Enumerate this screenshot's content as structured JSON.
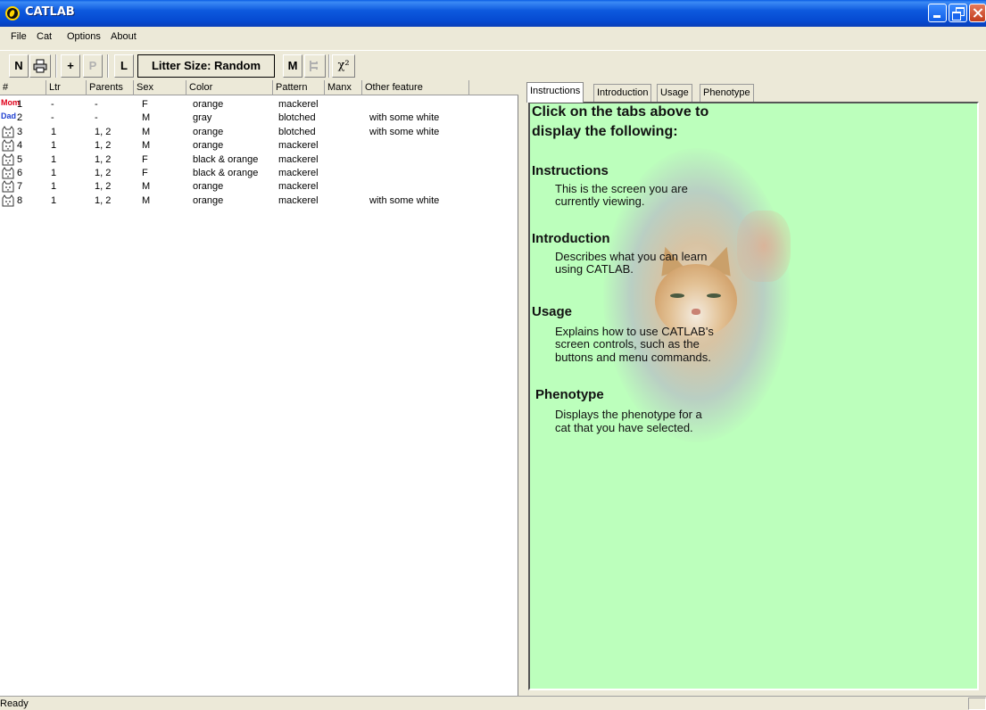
{
  "window": {
    "title": "CATLAB"
  },
  "menu": [
    "File",
    "Cat",
    "Options",
    "About"
  ],
  "toolbar": {
    "new": "N",
    "add": "+",
    "p": "P",
    "l": "L",
    "litter": "Litter Size: Random",
    "m": "M",
    "chi": "χ²"
  },
  "list": {
    "headers": [
      "#",
      "Ltr",
      "Parents",
      "Sex",
      "Color",
      "Pattern",
      "Manx",
      "Other feature"
    ],
    "rows": [
      {
        "icon": "mom",
        "icon_text": "Mom",
        "num": "1",
        "ltr": "-",
        "parents": "-",
        "sex": "F",
        "color": "orange",
        "pattern": "mackerel",
        "manx": "",
        "other": ""
      },
      {
        "icon": "dad",
        "icon_text": "Dad",
        "num": "2",
        "ltr": "-",
        "parents": "-",
        "sex": "M",
        "color": "gray",
        "pattern": "blotched",
        "manx": "",
        "other": "with some white"
      },
      {
        "icon": "cat",
        "icon_text": "",
        "num": "3",
        "ltr": "1",
        "parents": "1, 2",
        "sex": "M",
        "color": "orange",
        "pattern": "blotched",
        "manx": "",
        "other": "with some white"
      },
      {
        "icon": "cat",
        "icon_text": "",
        "num": "4",
        "ltr": "1",
        "parents": "1, 2",
        "sex": "M",
        "color": "orange",
        "pattern": "mackerel",
        "manx": "",
        "other": ""
      },
      {
        "icon": "cat",
        "icon_text": "",
        "num": "5",
        "ltr": "1",
        "parents": "1, 2",
        "sex": "F",
        "color": "black & orange",
        "pattern": "mackerel",
        "manx": "",
        "other": ""
      },
      {
        "icon": "cat",
        "icon_text": "",
        "num": "6",
        "ltr": "1",
        "parents": "1, 2",
        "sex": "F",
        "color": "black & orange",
        "pattern": "mackerel",
        "manx": "",
        "other": ""
      },
      {
        "icon": "cat",
        "icon_text": "",
        "num": "7",
        "ltr": "1",
        "parents": "1, 2",
        "sex": "M",
        "color": "orange",
        "pattern": "mackerel",
        "manx": "",
        "other": ""
      },
      {
        "icon": "cat",
        "icon_text": "",
        "num": "8",
        "ltr": "1",
        "parents": "1, 2",
        "sex": "M",
        "color": "orange",
        "pattern": "mackerel",
        "manx": "",
        "other": "with some white"
      }
    ]
  },
  "tabs": [
    "Instructions",
    "Introduction",
    "Usage",
    "Phenotype"
  ],
  "active_tab": "Instructions",
  "content": {
    "intro_line1": "Click on the tabs above to",
    "intro_line2": "display the following:",
    "sections": [
      {
        "title": "Instructions",
        "lines": [
          "This is the screen you are",
          "currently viewing."
        ]
      },
      {
        "title": "Introduction",
        "lines": [
          "Describes what you can learn",
          "using CATLAB."
        ]
      },
      {
        "title": "Usage",
        "lines": [
          "Explains how to use CATLAB's",
          "screen controls, such as the",
          "buttons  and menu commands."
        ]
      },
      {
        "title": "Phenotype",
        "lines": [
          "Displays the phenotype for a",
          "cat that you have selected."
        ]
      }
    ]
  },
  "status": {
    "text": "Ready"
  },
  "colors": {
    "content_bg": "#bcffbc",
    "title_bar": "#0549d0",
    "mom_icon": "#e0001a",
    "dad_icon": "#2040d0"
  },
  "icons": {
    "print": "printer-icon",
    "pedigree": "pedigree-icon",
    "cat": "cat-face-icon"
  }
}
